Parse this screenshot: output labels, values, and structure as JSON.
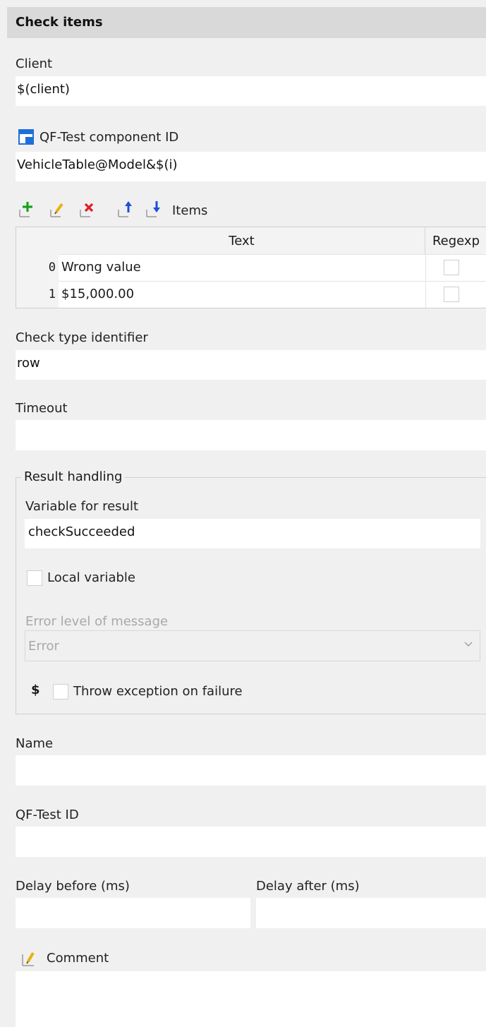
{
  "header": {
    "title": "Check items"
  },
  "client": {
    "label": "Client",
    "value": "$(client)"
  },
  "component": {
    "label": "QF-Test component ID",
    "value": "VehicleTable@Model&$(i)"
  },
  "items": {
    "label": "Items",
    "toolbar": [
      "add-icon",
      "edit-icon",
      "delete-icon",
      "move-up-icon",
      "move-down-icon"
    ],
    "columns": [
      "Text",
      "Regexp"
    ],
    "rows": [
      {
        "index": "0",
        "text": "Wrong value",
        "regexp": false
      },
      {
        "index": "1",
        "text": "$15,000.00",
        "regexp": false
      }
    ]
  },
  "check_type": {
    "label": "Check type identifier",
    "value": "row"
  },
  "timeout": {
    "label": "Timeout",
    "value": ""
  },
  "result_handling": {
    "title": "Result handling",
    "variable_label": "Variable for result",
    "variable_value": "checkSucceeded",
    "local_variable_label": "Local variable",
    "local_variable_checked": false,
    "error_level_label": "Error level of message",
    "error_level_value": "Error",
    "dollar_symbol": "$",
    "throw_label": "Throw exception on failure",
    "throw_checked": false
  },
  "name": {
    "label": "Name",
    "value": ""
  },
  "qftest_id": {
    "label": "QF-Test ID",
    "value": ""
  },
  "delay_before": {
    "label": "Delay before (ms)",
    "value": ""
  },
  "delay_after": {
    "label": "Delay after (ms)",
    "value": ""
  },
  "comment": {
    "label": "Comment",
    "value": ""
  },
  "colors": {
    "background": "#f0f0f0",
    "header": "#d9d9d9",
    "accent_blue": "#1e6fd9",
    "add_green": "#18a31b",
    "delete_red": "#e21c2a",
    "edit_yellow": "#e7b10e"
  }
}
